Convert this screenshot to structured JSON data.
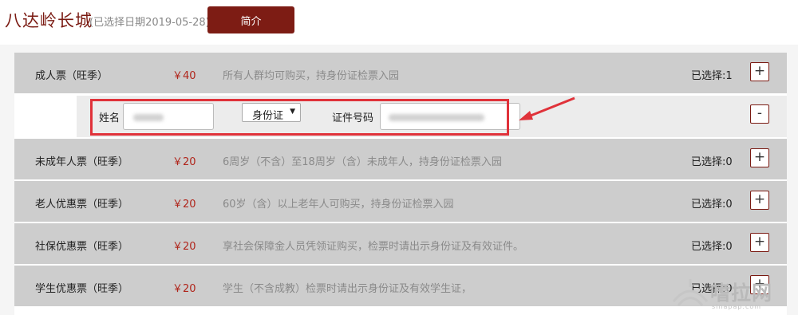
{
  "header": {
    "title": "八达岭长城",
    "date_note": "(已选择日期2019-05-28)",
    "intro_button": "简介"
  },
  "tickets": [
    {
      "name": "成人票（旺季）",
      "price": "￥40",
      "desc": "所有人群均可购买，持身份证检票入园",
      "selected": "已选择:1",
      "add": "+"
    },
    {
      "name": "未成年人票（旺季）",
      "price": "￥20",
      "desc": "6周岁（不含）至18周岁（含）未成年人，持身份证检票入园",
      "selected": "已选择:0",
      "add": "+"
    },
    {
      "name": "老人优惠票（旺季）",
      "price": "￥20",
      "desc": "60岁（含）以上老年人可购买，持身份证检票入园",
      "selected": "已选择:0",
      "add": "+"
    },
    {
      "name": "社保优惠票（旺季）",
      "price": "￥20",
      "desc": "享社会保障金人员凭领证购买，检票时请出示身份证及有效证件。",
      "selected": "已选择:0",
      "add": "+"
    },
    {
      "name": "学生优惠票（旺季）",
      "price": "￥20",
      "desc": "学生（不含成教）检票时请出示身份证及有效学生证，",
      "selected": "已选择:0",
      "add": "+"
    }
  ],
  "visitor_form": {
    "name_label": "姓名",
    "id_type_value": "身份证",
    "id_number_label": "证件号码",
    "remove": "-"
  },
  "watermark": {
    "text": "嗜拉网",
    "sub": "sinapap.com"
  },
  "colors": {
    "brand": "#7d1c14",
    "price": "#b0251b",
    "highlight": "#e0323a"
  }
}
